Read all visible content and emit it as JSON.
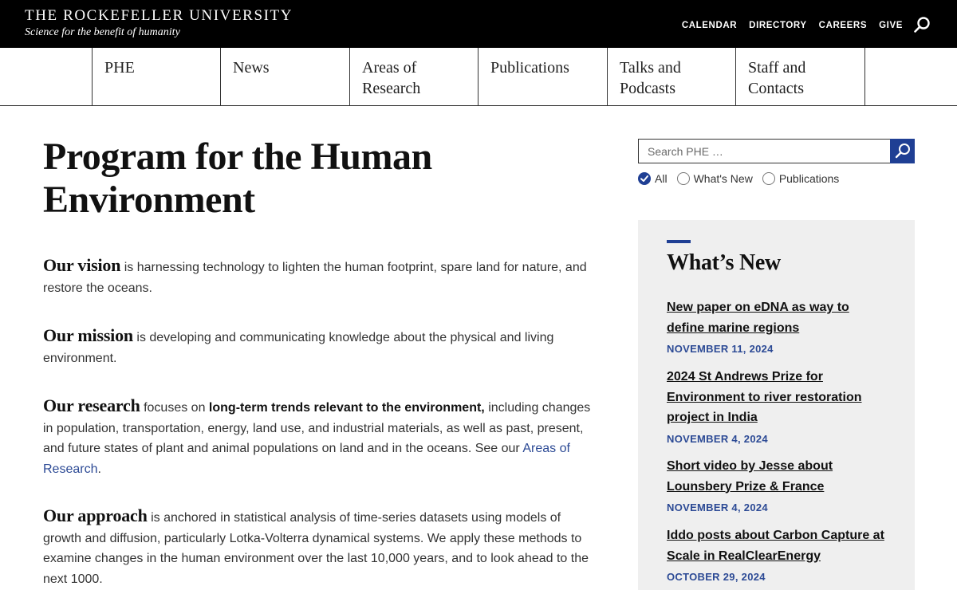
{
  "header": {
    "brand_name": "THE ROCKEFELLER UNIVERSITY",
    "brand_tagline": "Science for the benefit of humanity",
    "utility_nav": [
      "CALENDAR",
      "DIRECTORY",
      "CAREERS",
      "GIVE"
    ],
    "search_icon": "search-icon"
  },
  "section_nav": [
    "PHE",
    "News",
    "Areas of\nResearch",
    "Publications",
    "Talks and\nPodcasts",
    "Staff and\nContacts"
  ],
  "main": {
    "title": "Program for the Human Environment",
    "vision": {
      "lead": "Our vision",
      "text": " is harnessing technology to lighten the human footprint, spare land for nature, and restore the oceans."
    },
    "mission": {
      "lead": "Our mission",
      "text": " is developing and communicating knowledge about the physical and living environment."
    },
    "research": {
      "lead": "Our research",
      "text1": " focuses on ",
      "bold": "long-term trends relevant to the environment,",
      "text2": " including changes in population, transportation, energy, land use, and industrial materials, as well as past, present, and future states of plant and animal populations on land and in the oceans. See our ",
      "link": "Areas of Research",
      "text3": "."
    },
    "approach": {
      "lead": "Our approach",
      "text": " is anchored in statistical analysis of time-series datasets using models of growth and diffusion, particularly Lotka-Volterra dynamical systems. We apply these methods to examine changes in the human environment over the last 10,000 years, and to look ahead to the next 1000."
    }
  },
  "sidebar": {
    "search": {
      "placeholder": "Search PHE …"
    },
    "filters": [
      {
        "label": "All",
        "checked": true
      },
      {
        "label": "What's New",
        "checked": false
      },
      {
        "label": "Publications",
        "checked": false
      }
    ],
    "whats_new": {
      "title": "What’s New",
      "items": [
        {
          "title": "New paper on eDNA as way to define marine regions",
          "date": "NOVEMBER 11, 2024"
        },
        {
          "title": "2024 St Andrews Prize for Environment to river restoration project in India",
          "date": "NOVEMBER 4, 2024"
        },
        {
          "title": "Short video by Jesse about Lounsbery Prize & France",
          "date": "NOVEMBER 4, 2024"
        },
        {
          "title": "Iddo posts about Carbon Capture at Scale in RealClearEnergy",
          "date": "OCTOBER 29, 2024"
        }
      ]
    }
  },
  "colors": {
    "header_bg": "#000000",
    "accent_blue": "#1f3f94",
    "date_blue": "#2c4a95",
    "panel_bg": "#efefef"
  }
}
